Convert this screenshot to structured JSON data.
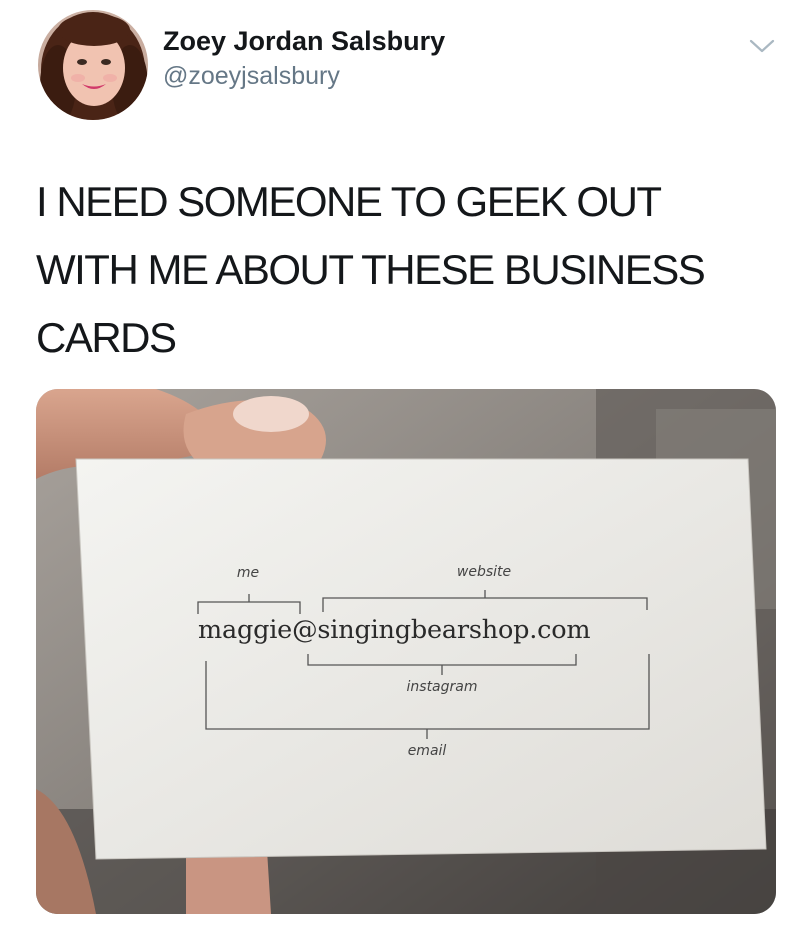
{
  "tweet": {
    "display_name": "Zoey Jordan Salsbury",
    "handle": "@zoeyjsalsbury",
    "text_lines": [
      "I NEED SOMEONE TO GEEK OUT",
      "WITH ME ABOUT THESE BUSINESS",
      "CARDS"
    ],
    "menu_icon": "chevron-down-icon"
  },
  "business_card": {
    "main_text": "maggie@singingbearshop.com",
    "labels": {
      "me": "me",
      "website": "website",
      "instagram": "instagram",
      "email": "email"
    }
  },
  "colors": {
    "name_text": "#14171a",
    "handle_text": "#657786",
    "card_text": "#2a2a2a"
  }
}
